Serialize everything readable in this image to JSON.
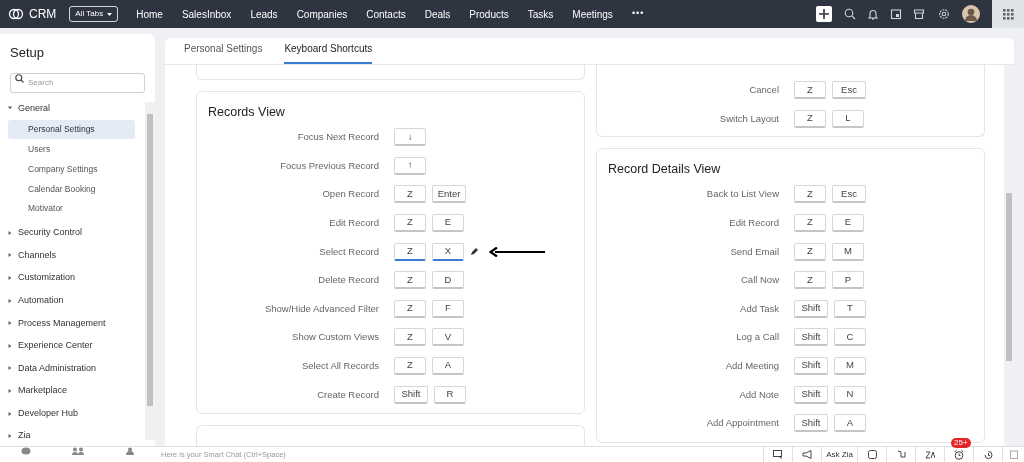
{
  "top_bar": {
    "brand": "CRM",
    "all_tabs": "All Tabs",
    "nav": [
      "Home",
      "SalesInbox",
      "Leads",
      "Companies",
      "Contacts",
      "Deals",
      "Products",
      "Tasks",
      "Meetings"
    ],
    "more": "•••"
  },
  "sidebar": {
    "title": "Setup",
    "search": {
      "placeholder": "Search"
    },
    "sections": [
      {
        "label": "General",
        "expanded": true,
        "children": [
          {
            "label": "Personal Settings",
            "selected": true
          },
          {
            "label": "Users",
            "selected": false
          },
          {
            "label": "Company Settings",
            "selected": false
          },
          {
            "label": "Calendar Booking",
            "selected": false
          },
          {
            "label": "Motivator",
            "selected": false
          }
        ]
      },
      {
        "label": "Security Control",
        "expanded": false
      },
      {
        "label": "Channels",
        "expanded": false
      },
      {
        "label": "Customization",
        "expanded": false
      },
      {
        "label": "Automation",
        "expanded": false
      },
      {
        "label": "Process Management",
        "expanded": false
      },
      {
        "label": "Experience Center",
        "expanded": false
      },
      {
        "label": "Data Administration",
        "expanded": false
      },
      {
        "label": "Marketplace",
        "expanded": false
      },
      {
        "label": "Developer Hub",
        "expanded": false
      },
      {
        "label": "Zia",
        "expanded": false
      }
    ]
  },
  "tabs": [
    {
      "label": "Personal Settings",
      "selected": false
    },
    {
      "label": "Keyboard Shortcuts",
      "selected": true
    }
  ],
  "left_column": [
    {
      "kind": "stub"
    },
    {
      "kind": "card",
      "title": "Records View",
      "shortcuts": [
        {
          "action": "Focus Next Record",
          "keys": [
            "↓"
          ],
          "selected": false,
          "annotated": false
        },
        {
          "action": "Focus Previous Record",
          "keys": [
            "↑"
          ],
          "selected": false,
          "annotated": false
        },
        {
          "action": "Open Record",
          "keys": [
            "Z",
            "Enter"
          ],
          "selected": false,
          "annotated": false
        },
        {
          "action": "Edit Record",
          "keys": [
            "Z",
            "E"
          ],
          "selected": false,
          "annotated": false
        },
        {
          "action": "Select Record",
          "keys": [
            "Z",
            "X"
          ],
          "selected": true,
          "annotated": true
        },
        {
          "action": "Delete Record",
          "keys": [
            "Z",
            "D"
          ],
          "selected": false,
          "annotated": false
        },
        {
          "action": "Show/Hide Advanced Filter",
          "keys": [
            "Z",
            "F"
          ],
          "selected": false,
          "annotated": false
        },
        {
          "action": "Show Custom Views",
          "keys": [
            "Z",
            "V"
          ],
          "selected": false,
          "annotated": false
        },
        {
          "action": "Select All Records",
          "keys": [
            "Z",
            "A"
          ],
          "selected": false,
          "annotated": false
        },
        {
          "action": "Create Record",
          "keys": [
            "Shift",
            "R"
          ],
          "selected": false,
          "annotated": false
        }
      ]
    },
    {
      "kind": "stub_bottom"
    }
  ],
  "right_column": [
    {
      "kind": "card_cut",
      "shortcuts": [
        {
          "action": "Cancel",
          "keys": [
            "Z",
            "Esc"
          ],
          "selected": false,
          "annotated": false
        },
        {
          "action": "Switch Layout",
          "keys": [
            "Z",
            "L"
          ],
          "selected": false,
          "annotated": false
        }
      ]
    },
    {
      "kind": "card",
      "title": "Record Details View",
      "shortcuts": [
        {
          "action": "Back to List View",
          "keys": [
            "Z",
            "Esc"
          ],
          "selected": false,
          "annotated": false
        },
        {
          "action": "Edit Record",
          "keys": [
            "Z",
            "E"
          ],
          "selected": false,
          "annotated": false
        },
        {
          "action": "Send Email",
          "keys": [
            "Z",
            "M"
          ],
          "selected": false,
          "annotated": false
        },
        {
          "action": "Call Now",
          "keys": [
            "Z",
            "P"
          ],
          "selected": false,
          "annotated": false
        },
        {
          "action": "Add Task",
          "keys": [
            "Shift",
            "T"
          ],
          "selected": false,
          "annotated": false
        },
        {
          "action": "Log a Call",
          "keys": [
            "Shift",
            "C"
          ],
          "selected": false,
          "annotated": false
        },
        {
          "action": "Add Meeting",
          "keys": [
            "Shift",
            "M"
          ],
          "selected": false,
          "annotated": false
        },
        {
          "action": "Add Note",
          "keys": [
            "Shift",
            "N"
          ],
          "selected": false,
          "annotated": false
        },
        {
          "action": "Add Appointment",
          "keys": [
            "Shift",
            "A"
          ],
          "selected": false,
          "annotated": false
        }
      ]
    }
  ],
  "bottom_bar": {
    "smart_chat": {
      "placeholder": "Here is your Smart Chat (Ctrl+Space)"
    },
    "ask_zia": "Ask Zia",
    "reminder_badge": "25+"
  }
}
